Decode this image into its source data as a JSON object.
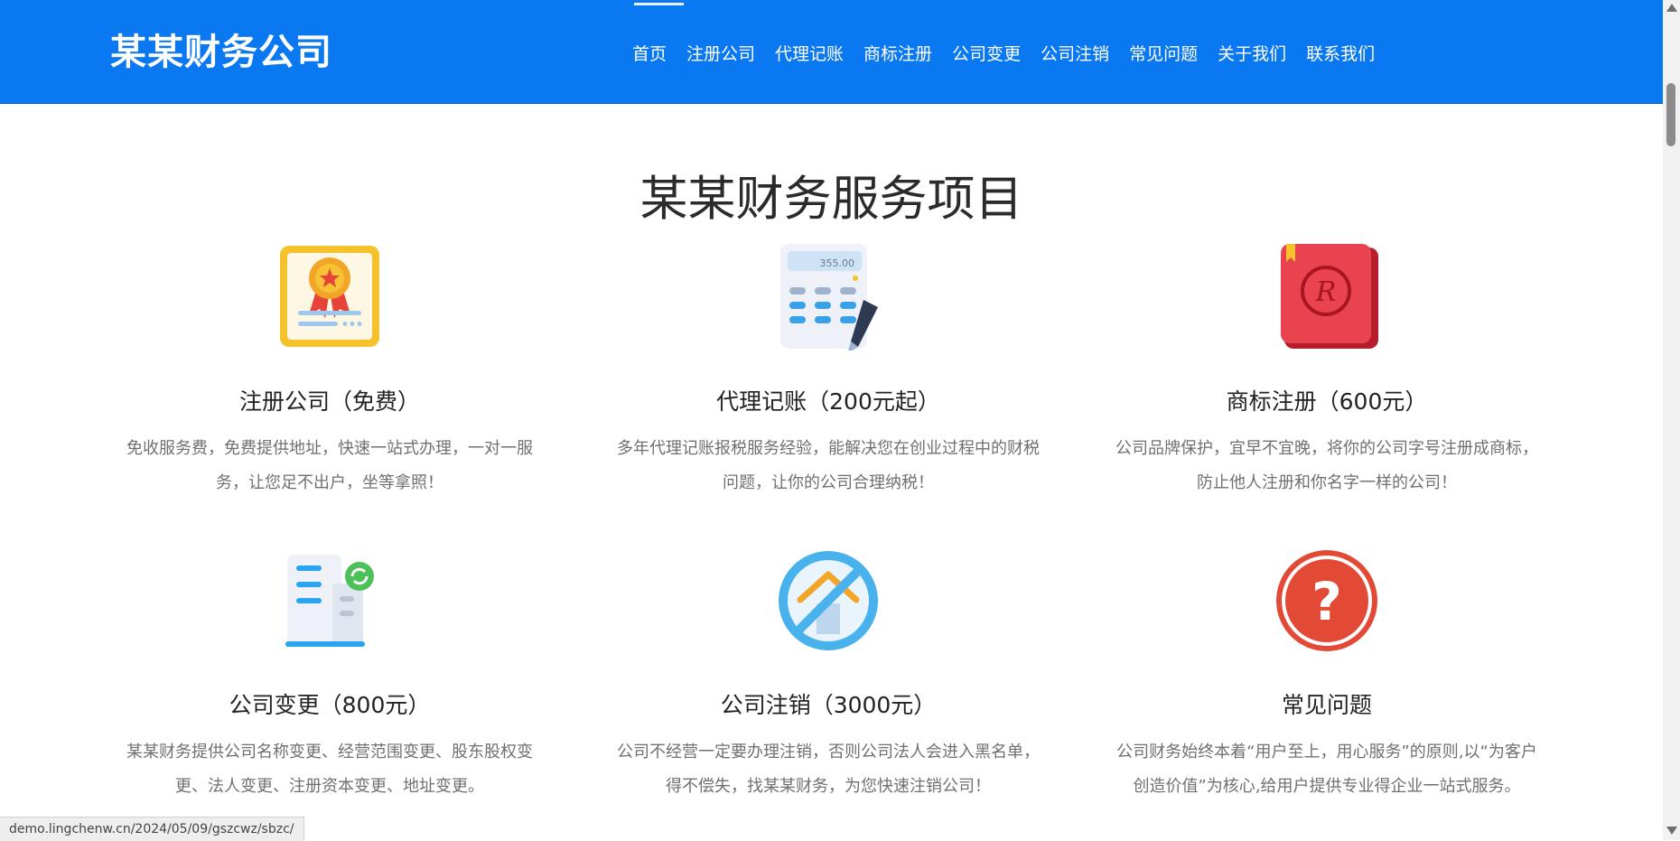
{
  "header": {
    "logo": "某某财务公司",
    "nav": [
      "首页",
      "注册公司",
      "代理记账",
      "商标注册",
      "公司变更",
      "公司注销",
      "常见问题",
      "关于我们",
      "联系我们"
    ]
  },
  "section": {
    "title": "某某财务服务项目"
  },
  "services": [
    {
      "title": "注册公司（免费）",
      "desc": "免收服务费，免费提供地址，快速一站式办理，一对一服务，让您足不出户，坐等拿照！",
      "icon": "certificate-icon"
    },
    {
      "title": "代理记账（200元起）",
      "desc": "多年代理记账报税服务经验，能解决您在创业过程中的财税问题，让你的公司合理纳税！",
      "icon": "calculator-icon",
      "calc_display": "355.00"
    },
    {
      "title": "商标注册（600元）",
      "desc": "公司品牌保护，宜早不宜晚，将你的公司字号注册成商标，防止他人注册和你名字一样的公司！",
      "icon": "trademark-book-icon",
      "badge": "R"
    },
    {
      "title": "公司变更（800元）",
      "desc": "某某财务提供公司名称变更、经营范围变更、股东股权变更、法人变更、注册资本变更、地址变更。",
      "icon": "building-change-icon"
    },
    {
      "title": "公司注销（3000元）",
      "desc": "公司不经营一定要办理注销，否则公司法人会进入黑名单，得不偿失，找某某财务，为您快速注销公司！",
      "icon": "cancel-house-icon"
    },
    {
      "title": "常见问题",
      "desc": "公司财务始终本着“用户至上，用心服务”的原则,以“为客户创造价值”为核心,给用户提供专业得企业一站式服务。",
      "icon": "question-icon",
      "badge": "?"
    }
  ],
  "status_bar": {
    "url": "demo.lingchenw.cn/2024/05/09/gszcwz/sbzc/"
  },
  "colors": {
    "header_bg": "#0a78f0",
    "text_dark": "#222222",
    "text_muted": "#707070"
  }
}
